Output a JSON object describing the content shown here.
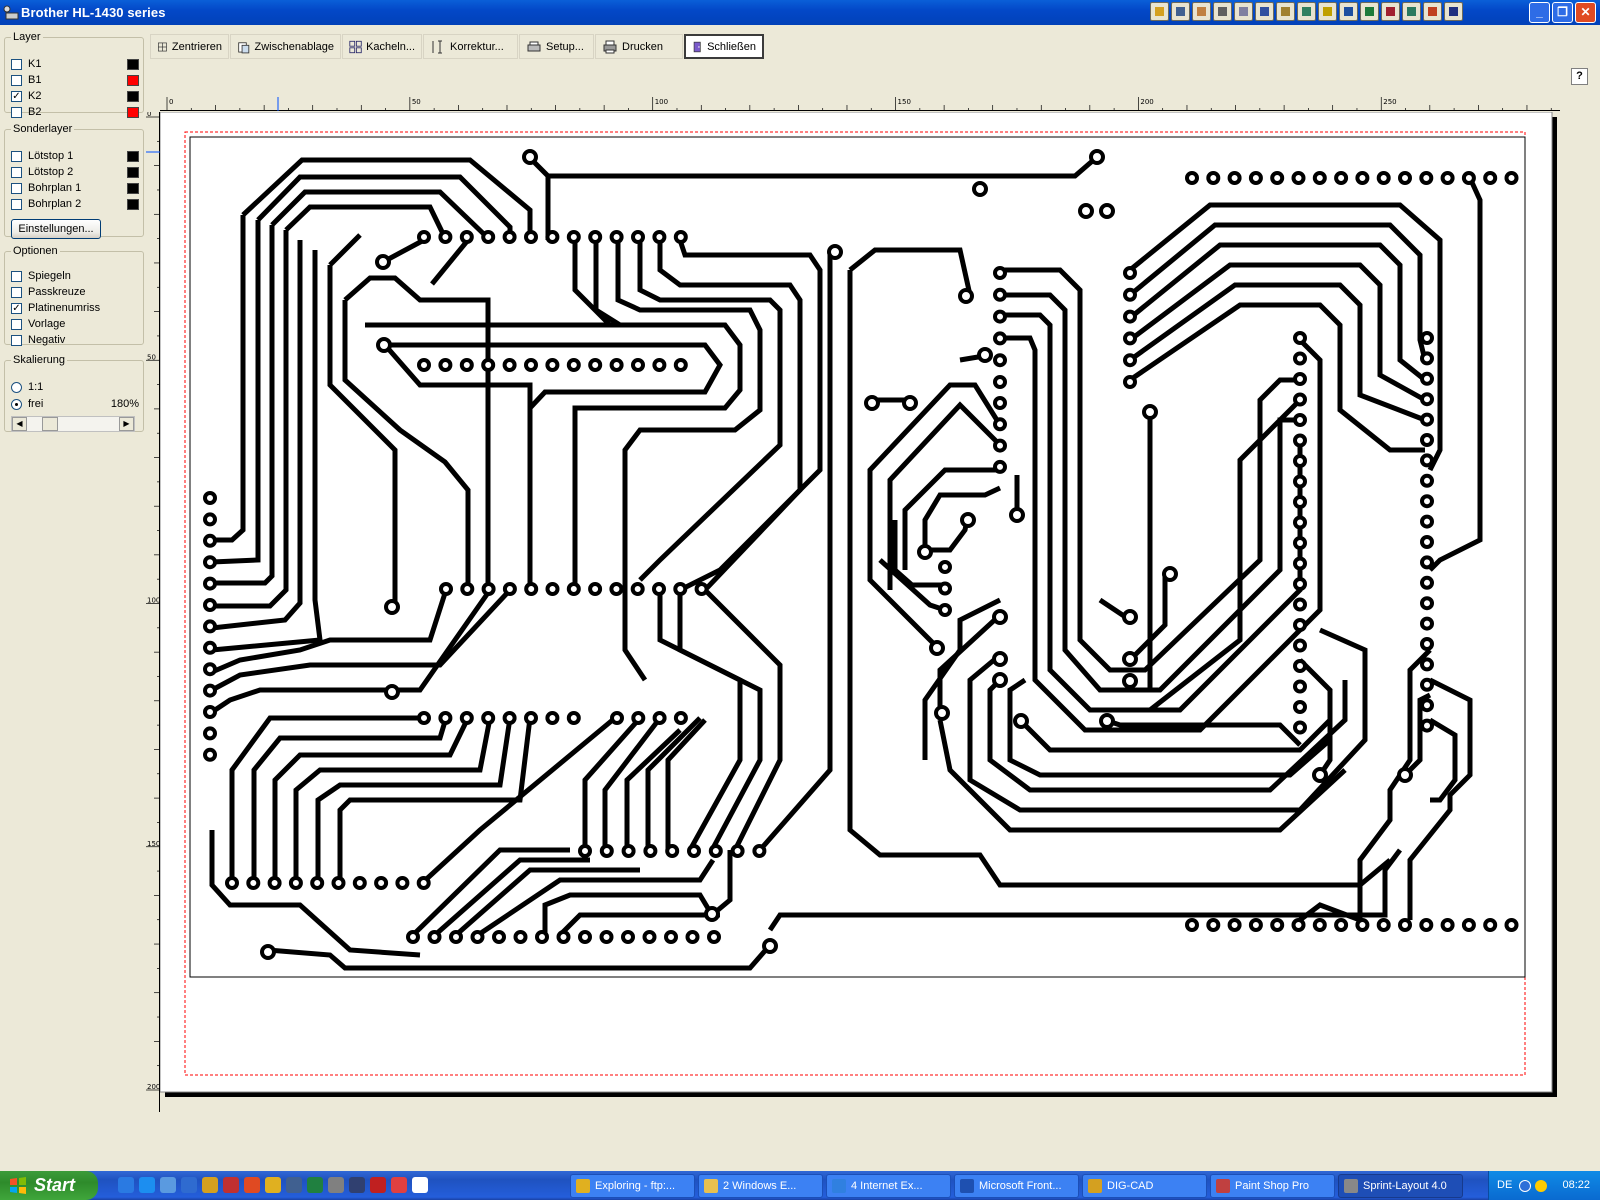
{
  "window": {
    "title": "Brother HL-1430 series"
  },
  "title_icons": [
    "outlook-icon",
    "folder-icon",
    "clipboard-icon",
    "mail-icon",
    "window-icon",
    "calendar-icon",
    "card-icon",
    "contact-icon",
    "note-icon",
    "word-icon",
    "excel-icon",
    "access-icon",
    "publisher-icon",
    "powerpoint-icon",
    "app-icon"
  ],
  "toolbar": {
    "zentrieren": "Zentrieren",
    "zwischenablage": "Zwischenablage",
    "kacheln": "Kacheln...",
    "korrektur": "Korrektur...",
    "setup": "Setup...",
    "drucken": "Drucken",
    "schliessen": "Schließen",
    "help": "?"
  },
  "layer": {
    "title": "Layer",
    "items": [
      {
        "label": "K1",
        "checked": false,
        "color": "#000000"
      },
      {
        "label": "B1",
        "checked": false,
        "color": "#ff0000"
      },
      {
        "label": "K2",
        "checked": true,
        "color": "#000000"
      },
      {
        "label": "B2",
        "checked": false,
        "color": "#ff0000"
      }
    ]
  },
  "sonderlayer": {
    "title": "Sonderlayer",
    "items": [
      {
        "label": "Lötstop 1",
        "checked": false,
        "color": "#000000"
      },
      {
        "label": "Lötstop 2",
        "checked": false,
        "color": "#000000"
      },
      {
        "label": "Bohrplan 1",
        "checked": false,
        "color": "#000000"
      },
      {
        "label": "Bohrplan 2",
        "checked": false,
        "color": "#000000"
      }
    ],
    "settings_button": "Einstellungen..."
  },
  "optionen": {
    "title": "Optionen",
    "items": [
      {
        "label": "Spiegeln",
        "checked": false
      },
      {
        "label": "Passkreuze",
        "checked": false
      },
      {
        "label": "Platinenumriss",
        "checked": true
      },
      {
        "label": "Vorlage",
        "checked": false
      },
      {
        "label": "Negativ",
        "checked": false
      }
    ]
  },
  "skalierung": {
    "title": "Skalierung",
    "option_1": "1:1",
    "option_2": "frei",
    "selected": "frei",
    "value": "180%"
  },
  "ruler": {
    "top_labels": [
      "0",
      "50",
      "100",
      "150",
      "200",
      "250"
    ],
    "left_labels": [
      "0",
      "50",
      "100",
      "150",
      "200"
    ]
  },
  "taskbar": {
    "start": "Start",
    "tasks": [
      {
        "label": "Exploring - ftp:...",
        "active": false
      },
      {
        "label": "2 Windows E...",
        "active": false
      },
      {
        "label": "4 Internet Ex...",
        "active": false
      },
      {
        "label": "Microsoft Front...",
        "active": false
      },
      {
        "label": "DIG-CAD",
        "active": false
      },
      {
        "label": "Paint Shop Pro",
        "active": false
      },
      {
        "label": "Sprint-Layout 4.0",
        "active": true
      }
    ],
    "language": "DE",
    "clock": "08:22"
  },
  "colors": {
    "titlebar": "#0348c8",
    "taskbar": "#245edb",
    "start": "#3c9b3a",
    "trace": "#000000",
    "board_outline": "#ff0000"
  }
}
